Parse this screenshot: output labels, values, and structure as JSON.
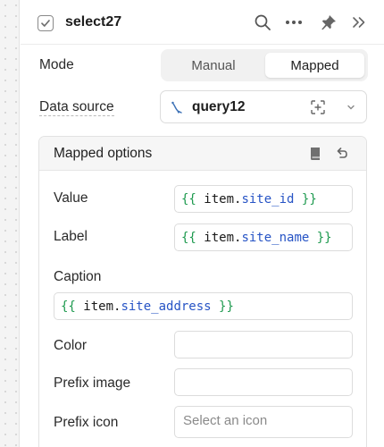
{
  "component": {
    "name": "select27"
  },
  "mode": {
    "label": "Mode",
    "options": [
      "Manual",
      "Mapped"
    ],
    "selected": "Mapped"
  },
  "data_source": {
    "label": "Data source",
    "value": "query12"
  },
  "mapped_options": {
    "title": "Mapped options",
    "fields": {
      "value": {
        "label": "Value",
        "brace_open": "{{",
        "obj": "item",
        "prop": "site_id",
        "brace_close": "}}"
      },
      "label": {
        "label": "Label",
        "brace_open": "{{",
        "obj": "item",
        "prop": "site_name",
        "brace_close": "}}"
      },
      "caption": {
        "label": "Caption",
        "brace_open": "{{",
        "obj": "item",
        "prop": "site_address",
        "brace_close": "}}"
      },
      "color": {
        "label": "Color",
        "value": ""
      },
      "prefix_image": {
        "label": "Prefix image",
        "value": ""
      },
      "prefix_icon": {
        "label": "Prefix icon",
        "placeholder": "Select an icon"
      }
    }
  },
  "colors": {
    "accent_green": "#1e9a4f",
    "accent_blue": "#2754c5",
    "border": "#dcdcdc"
  }
}
